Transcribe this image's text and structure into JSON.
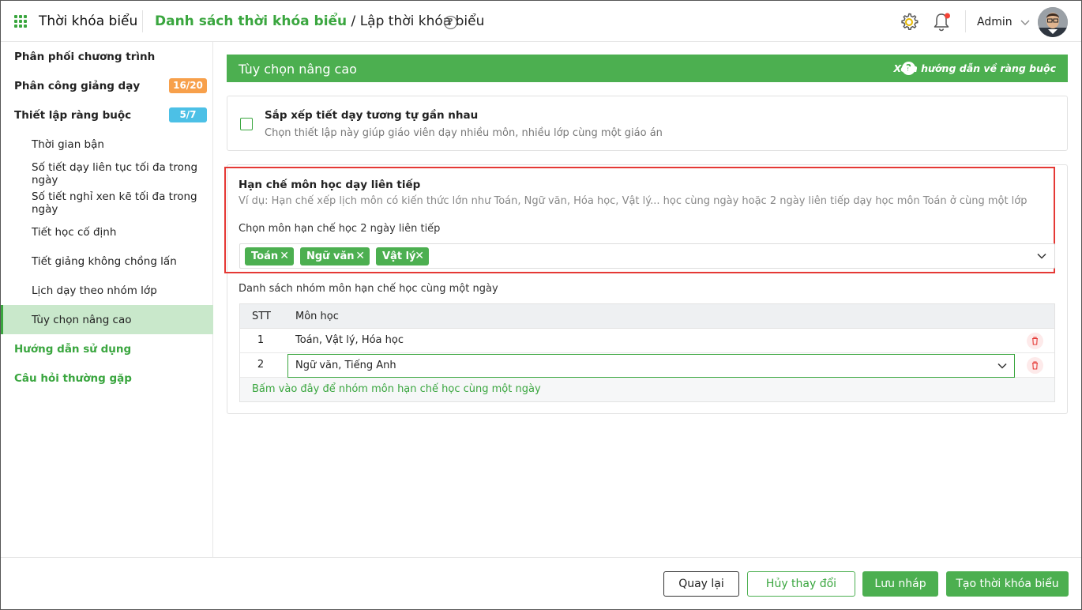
{
  "header": {
    "app_title": "Thời khóa biểu",
    "breadcrumb_link": "Danh sách thời khóa biểu",
    "breadcrumb_sep": " / ",
    "breadcrumb_current": "Lập thời khóa biểu",
    "user_name": "Admin",
    "notification_dot_color": "#f44336"
  },
  "sidebar": {
    "items": [
      {
        "label": "Phân phối chương trình"
      },
      {
        "label": "Phân công giảng dạy",
        "badge": "16/20"
      },
      {
        "label": "Thiết lập ràng buộc",
        "badge": "5/7"
      },
      {
        "label": "Thời gian bận"
      },
      {
        "label": "Số tiết dạy liên tục tối đa trong ngày"
      },
      {
        "label": "Số tiết nghỉ xen kẽ tối đa trong ngày"
      },
      {
        "label": "Tiết học cố định"
      },
      {
        "label": "Tiết giảng không chồng lấn"
      },
      {
        "label": "Lịch dạy theo nhóm lớp"
      },
      {
        "label": "Tùy chọn nâng cao",
        "active": true
      },
      {
        "label": "Hướng dẫn sử dụng"
      },
      {
        "label": "Câu hỏi thường gặp"
      }
    ]
  },
  "main": {
    "section_title": "Tùy chọn nâng cao",
    "guide_link": "Xem hướng dẫn về ràng buộc",
    "option1": {
      "title": "Sắp xếp tiết dạy tương tự gần nhau",
      "description": "Chọn thiết lập này giúp giáo viên dạy nhiều môn, nhiều lớp cùng một giáo án",
      "checked": false
    },
    "option2": {
      "title": "Hạn chế môn học dạy liên tiếp",
      "description": "Ví dụ: Hạn chế xếp lịch môn có kiến thức lớn như Toán, Ngữ văn, Hóa học, Vật lý... học cùng ngày hoặc 2 ngày liên tiếp dạy học môn Toán ở cùng một lớp",
      "select_label": "Chọn môn hạn chế học 2 ngày liên tiếp",
      "tags": [
        "Toán",
        "Ngữ văn",
        "Vật lý"
      ],
      "list_label": "Danh sách nhóm môn hạn chế học cùng một ngày",
      "table": {
        "col_stt": "STT",
        "col_subject": "Môn học",
        "rows": [
          {
            "stt": "1",
            "subjects": "Toán, Vật lý, Hóa học"
          },
          {
            "stt": "2",
            "subjects": "Ngữ văn, Tiếng Anh"
          }
        ],
        "add_link": "Bấm vào đây để nhóm môn hạn chế học cùng một ngày"
      }
    }
  },
  "footer": {
    "back": "Quay lại",
    "cancel": "Hủy thay đổi",
    "save_draft": "Lưu nháp",
    "create": "Tạo thời khóa biểu"
  },
  "colors": {
    "brand_green": "#4caf50",
    "highlight_red": "#e53935",
    "badge_orange": "#f7a04b",
    "badge_blue": "#4cc0e6"
  }
}
